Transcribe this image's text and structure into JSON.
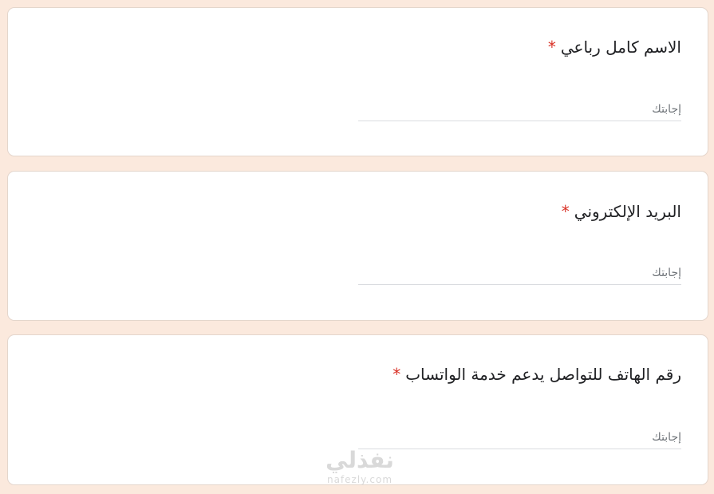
{
  "form": {
    "questions": [
      {
        "title": "الاسم كامل رباعي",
        "required_mark": "*",
        "placeholder": "إجابتك"
      },
      {
        "title": "البريد الإلكتروني",
        "required_mark": "*",
        "placeholder": "إجابتك"
      },
      {
        "title": "رقم الهاتف للتواصل يدعم خدمة الواتساب",
        "required_mark": "*",
        "placeholder": "إجابتك"
      }
    ]
  },
  "watermark": {
    "logo_text": "نفذلي",
    "url": "nafezly.com"
  },
  "colors": {
    "page_background": "#fbe9dd",
    "card_background": "#ffffff",
    "required_mark": "#d93025",
    "underline": "#dadce0"
  }
}
